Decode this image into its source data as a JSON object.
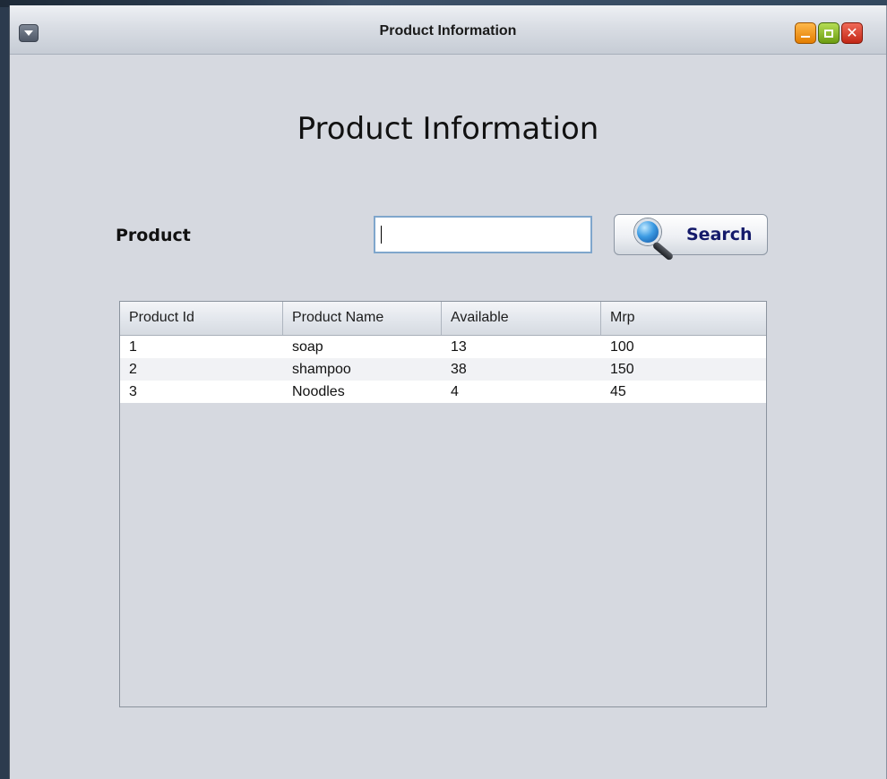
{
  "window": {
    "title": "Product Information"
  },
  "form": {
    "heading": "Product Information",
    "product_label": "Product",
    "product_value": "",
    "search_label": "Search"
  },
  "table": {
    "columns": [
      "Product Id",
      "Product Name",
      "Available",
      "Mrp"
    ],
    "rows": [
      [
        "1",
        "soap",
        "13",
        "100"
      ],
      [
        "2",
        "shampoo",
        "38",
        "150"
      ],
      [
        "3",
        "Noodles",
        "4",
        "45"
      ]
    ]
  },
  "colors": {
    "window_background": "#d6d9e0",
    "search_label_color": "#141a6a",
    "minimize_button": "#e37d00",
    "maximize_button": "#6c9b11",
    "close_button": "#c22716"
  },
  "icons": {
    "system_menu": "chevron-down-icon",
    "search": "search-icon",
    "minimize": "minimize-icon",
    "maximize": "maximize-icon",
    "close": "close-icon"
  }
}
